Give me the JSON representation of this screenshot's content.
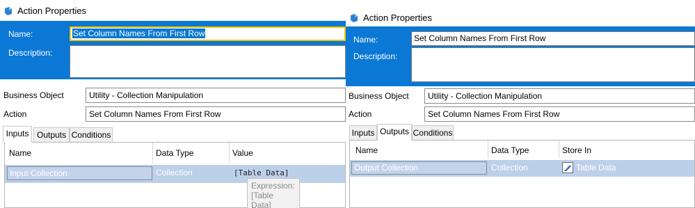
{
  "left": {
    "title": "Action Properties",
    "name_label": "Name:",
    "name_value": "Set Column Names From First Row",
    "description_label": "Description:",
    "description_value": "",
    "business_object_label": "Business Object",
    "business_object_value": "Utility - Collection Manipulation",
    "action_label": "Action",
    "action_value": "Set Column Names From First Row",
    "tabs": [
      "Inputs",
      "Outputs",
      "Conditions"
    ],
    "active_tab": "Inputs",
    "columns": [
      "Name",
      "Data Type",
      "Value"
    ],
    "row": {
      "name": "Input Collection",
      "data_type": "Collection",
      "value": "[Table Data]"
    },
    "tooltip_line1": "Expression:",
    "tooltip_line2": "[Table Data]"
  },
  "right": {
    "title": "Action Properties",
    "name_label": "Name:",
    "name_value": "Set Column Names From First Row",
    "description_label": "Description:",
    "description_value": "",
    "business_object_label": "Business Object",
    "business_object_value": "Utility - Collection Manipulation",
    "action_label": "Action",
    "action_value": "Set Column Names From First Row",
    "tabs": [
      "Inputs",
      "Outputs",
      "Conditions"
    ],
    "active_tab": "Outputs",
    "columns": [
      "Name",
      "Data Type",
      "Store In"
    ],
    "row": {
      "name": "Output Collection",
      "data_type": "Collection",
      "store_in": "Table Data"
    }
  },
  "colors": {
    "header_blue": "#0a78d4",
    "row_selected": "#bcd0ea",
    "focus_border": "#f2c200"
  },
  "icons": {
    "title": "action-properties-icon",
    "store_in": "data-item-icon"
  }
}
